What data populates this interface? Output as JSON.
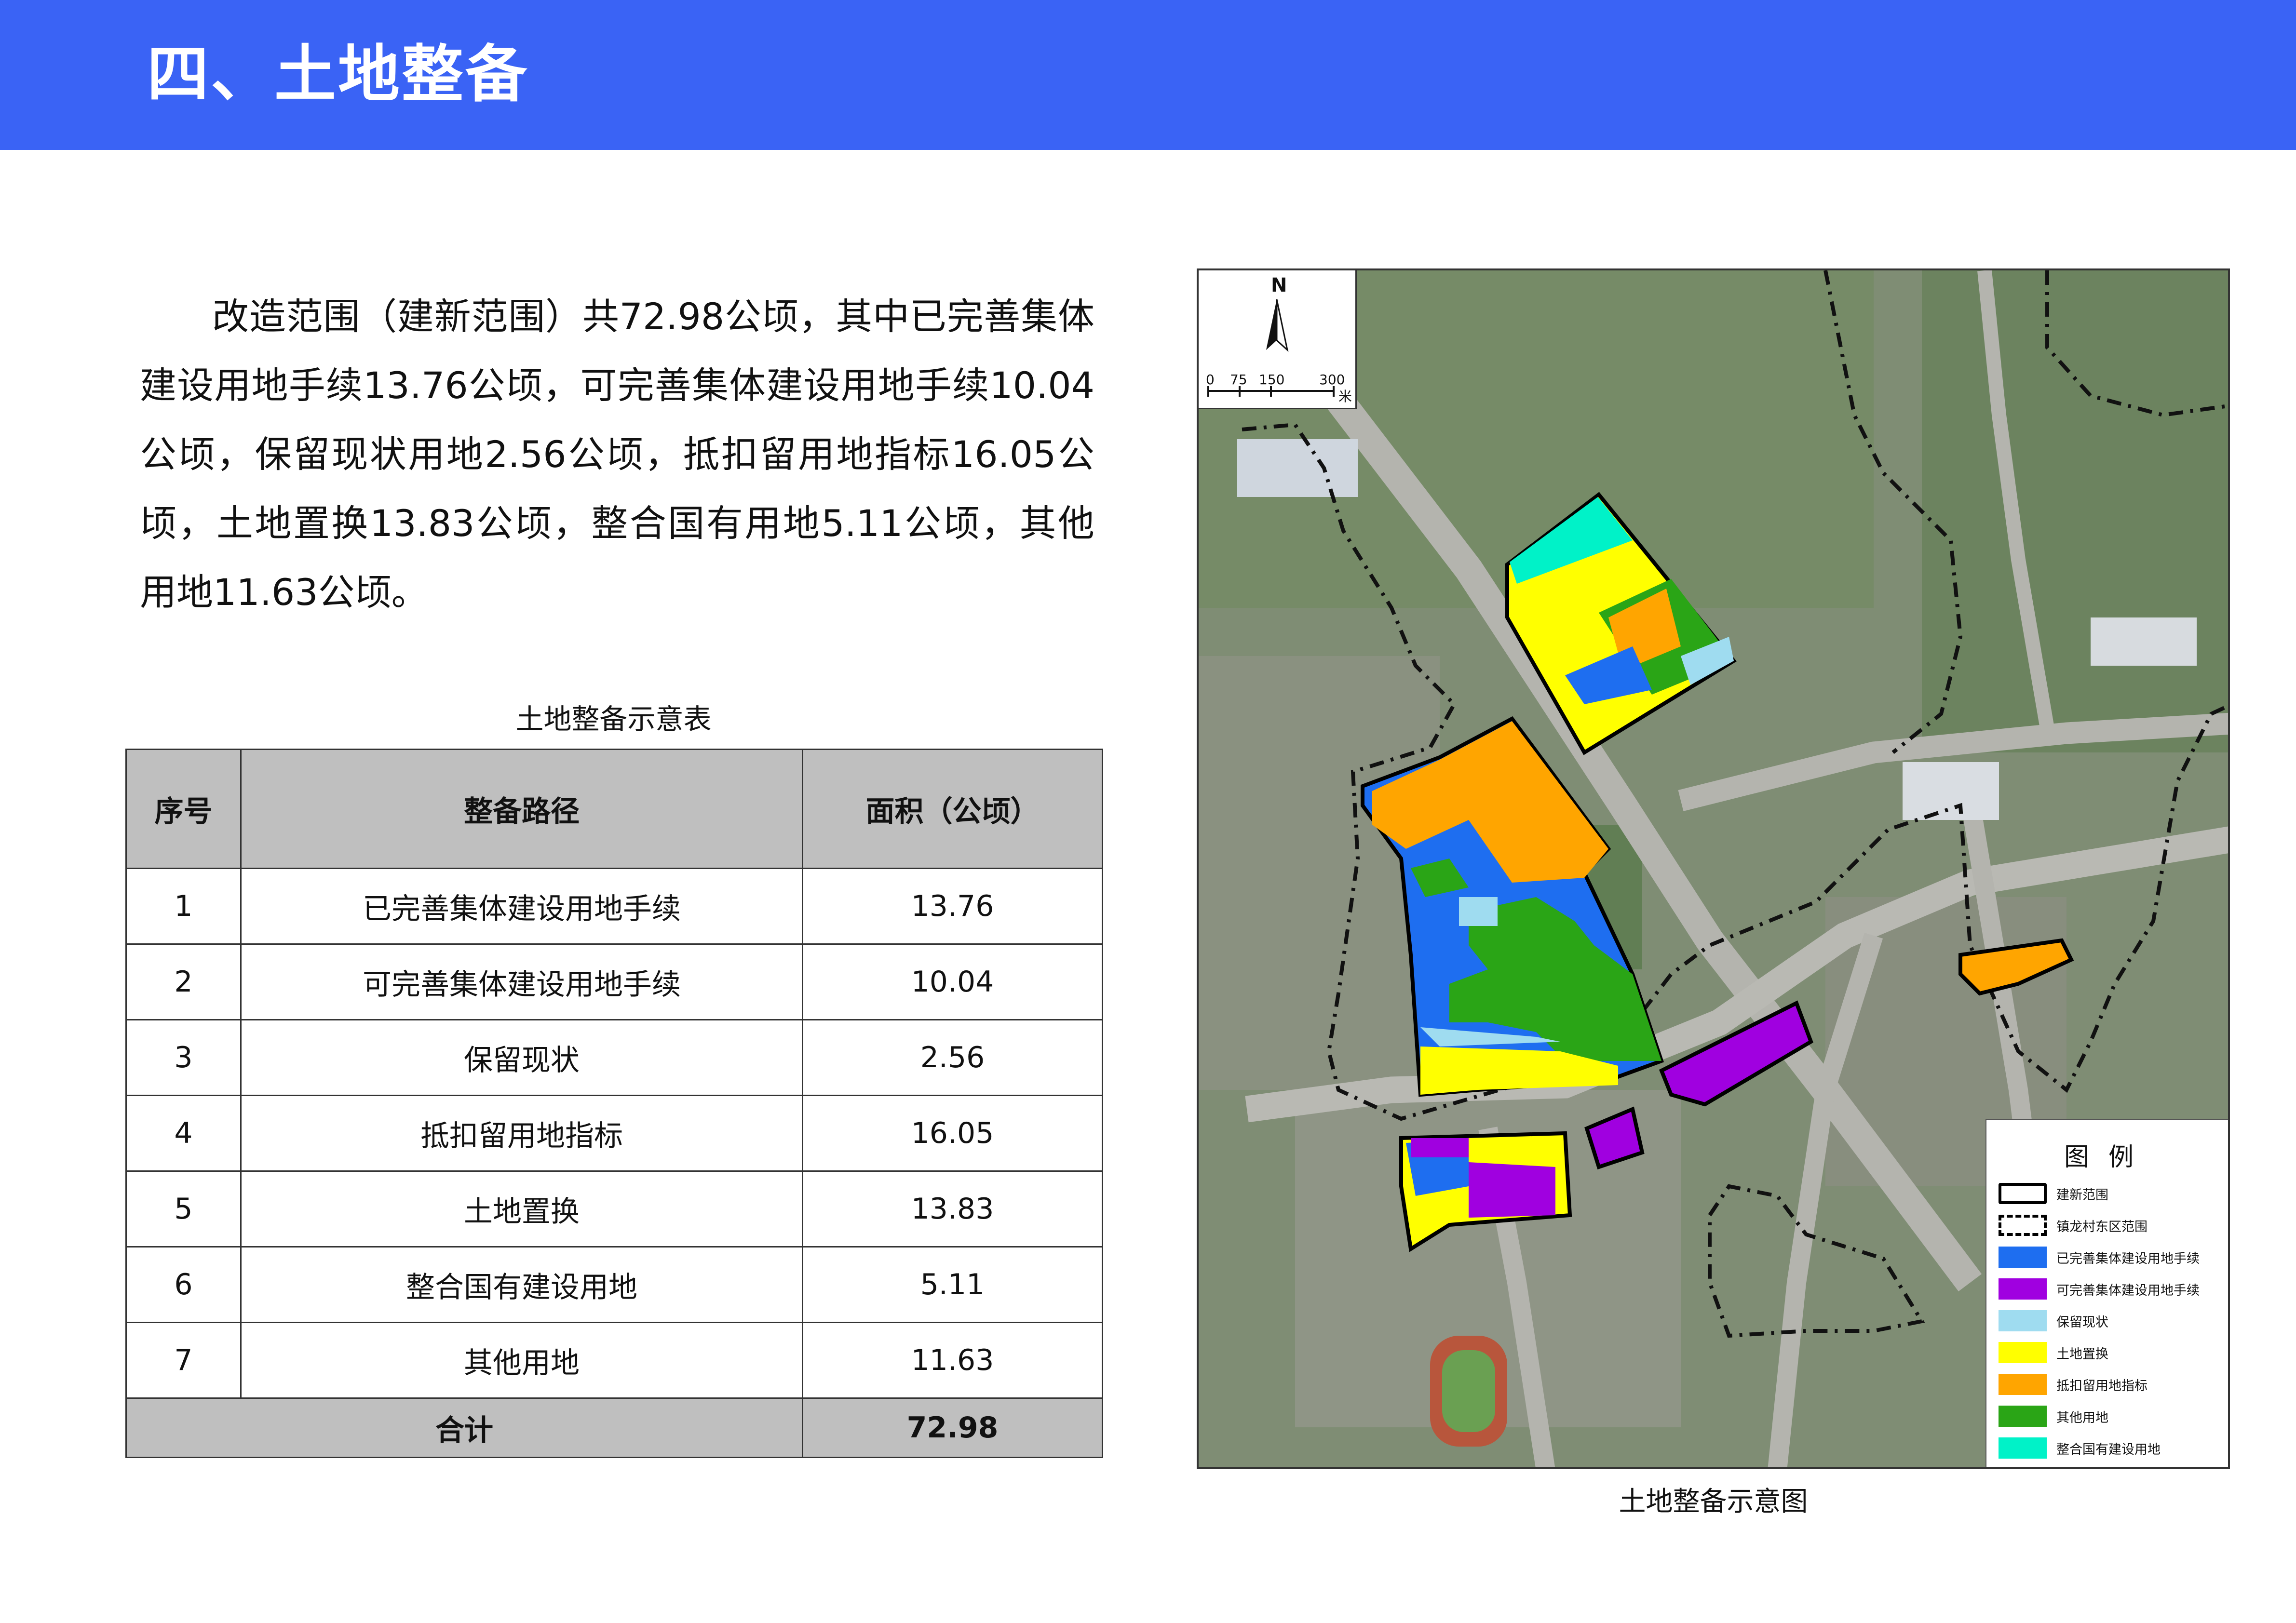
{
  "header": {
    "title": "四、土地整备"
  },
  "intro_text": "改造范围（建新范围）共72.98公顷，其中已完善集体建设用地手续13.76公顷，可完善集体建设用地手续10.04公顷，保留现状用地2.56公顷，抵扣留用地指标16.05公顷，土地置换13.83公顷，整合国有用地5.11公顷，其他用地11.63公顷。",
  "table": {
    "caption": "土地整备示意表",
    "headers": [
      "序号",
      "整备路径",
      "面积（公顷）"
    ],
    "rows": [
      [
        "1",
        "已完善集体建设用地手续",
        "13.76"
      ],
      [
        "2",
        "可完善集体建设用地手续",
        "10.04"
      ],
      [
        "3",
        "保留现状",
        "2.56"
      ],
      [
        "4",
        "抵扣留用地指标",
        "16.05"
      ],
      [
        "5",
        "土地置换",
        "13.83"
      ],
      [
        "6",
        "整合国有建设用地",
        "5.11"
      ],
      [
        "7",
        "其他用地",
        "11.63"
      ]
    ],
    "total_label": "合计",
    "total_value": "72.98"
  },
  "map": {
    "caption": "土地整备示意图",
    "north_label": "N",
    "scale_labels": [
      "0",
      "75",
      "150",
      "300",
      "米"
    ],
    "legend": {
      "title": "图例",
      "items": [
        {
          "label": "建新范围",
          "style": "solid-outline",
          "color": "#000000"
        },
        {
          "label": "镇龙村东区范围",
          "style": "dashed-outline",
          "color": "#000000"
        },
        {
          "label": "已完善集体建设用地手续",
          "style": "fill",
          "color": "#1e6ef0"
        },
        {
          "label": "可完善集体建设用地手续",
          "style": "fill",
          "color": "#a000e0"
        },
        {
          "label": "保留现状",
          "style": "fill",
          "color": "#9fdcf0"
        },
        {
          "label": "土地置换",
          "style": "fill",
          "color": "#ffff00"
        },
        {
          "label": "抵扣留用地指标",
          "style": "fill",
          "color": "#ffa500"
        },
        {
          "label": "其他用地",
          "style": "fill",
          "color": "#2aa516"
        },
        {
          "label": "整合国有建设用地",
          "style": "fill",
          "color": "#00f2c8"
        }
      ]
    }
  },
  "colors": {
    "banner": "#3a63f5",
    "table_header_bg": "#bfbfbf"
  }
}
